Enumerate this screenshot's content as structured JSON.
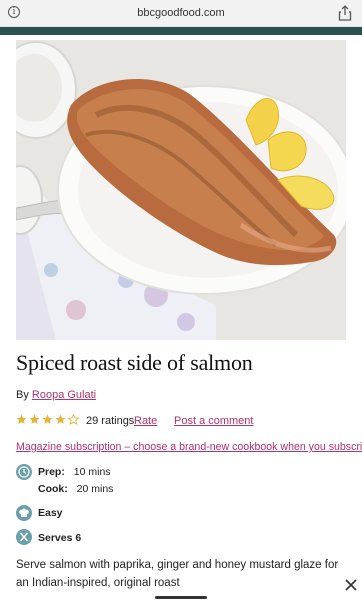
{
  "browser": {
    "url": "bbcgoodfood.com",
    "info_icon": "info-icon",
    "share_icon": "share-icon"
  },
  "colors": {
    "brand_bar": "#29514d",
    "link": "#b0336b",
    "star": "#e9b23a",
    "meta_icon": "#6aa0a8"
  },
  "recipe": {
    "title": "Spiced roast side of salmon",
    "by_prefix": "By",
    "author": "Roopa Gulati",
    "rating_value": 4,
    "rating_max": 5,
    "ratings_count": "29 ratings",
    "rate_label": "Rate",
    "post_comment_label": "Post a comment",
    "promo_text": "Magazine subscription – choose a brand-new cookbook when you subscribe",
    "prep_label": "Prep:",
    "prep_value": "10 mins",
    "cook_label": "Cook:",
    "cook_value": "20 mins",
    "difficulty": "Easy",
    "serves": "Serves 6",
    "description": "Serve salmon with paprika, ginger and honey mustard glaze for an Indian-inspired, original roast"
  },
  "icons": {
    "time": "clock-icon",
    "difficulty": "chef-hat-icon",
    "serves": "cutlery-icon",
    "close": "close-icon"
  }
}
